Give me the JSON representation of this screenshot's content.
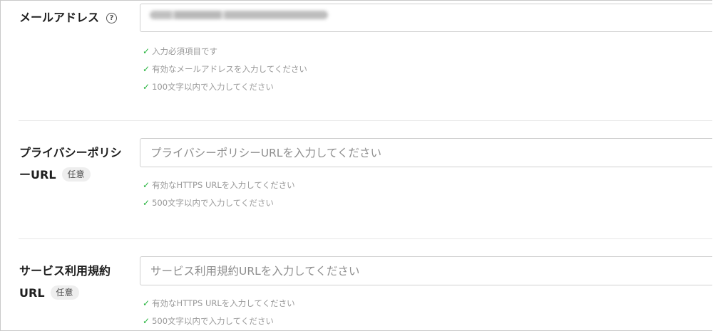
{
  "email": {
    "label": "メールアドレス",
    "help_icon": "?",
    "rules": [
      "入力必須項目です",
      "有効なメールアドレスを入力してください",
      "100文字以内で入力してください"
    ]
  },
  "privacy": {
    "label_line1": "プライバシーポリシ",
    "label_line2": "ーURL",
    "optional_badge": "任意",
    "placeholder": "プライバシーポリシーURLを入力してください",
    "rules": [
      "有効なHTTPS URLを入力してください",
      "500文字以内で入力してください"
    ]
  },
  "terms": {
    "label_line1": "サービス利用規約",
    "label_line2": "URL",
    "optional_badge": "任意",
    "placeholder": "サービス利用規約URLを入力してください",
    "rules": [
      "有効なHTTPS URLを入力してください",
      "500文字以内で入力してください"
    ]
  },
  "check_icon": "✓"
}
